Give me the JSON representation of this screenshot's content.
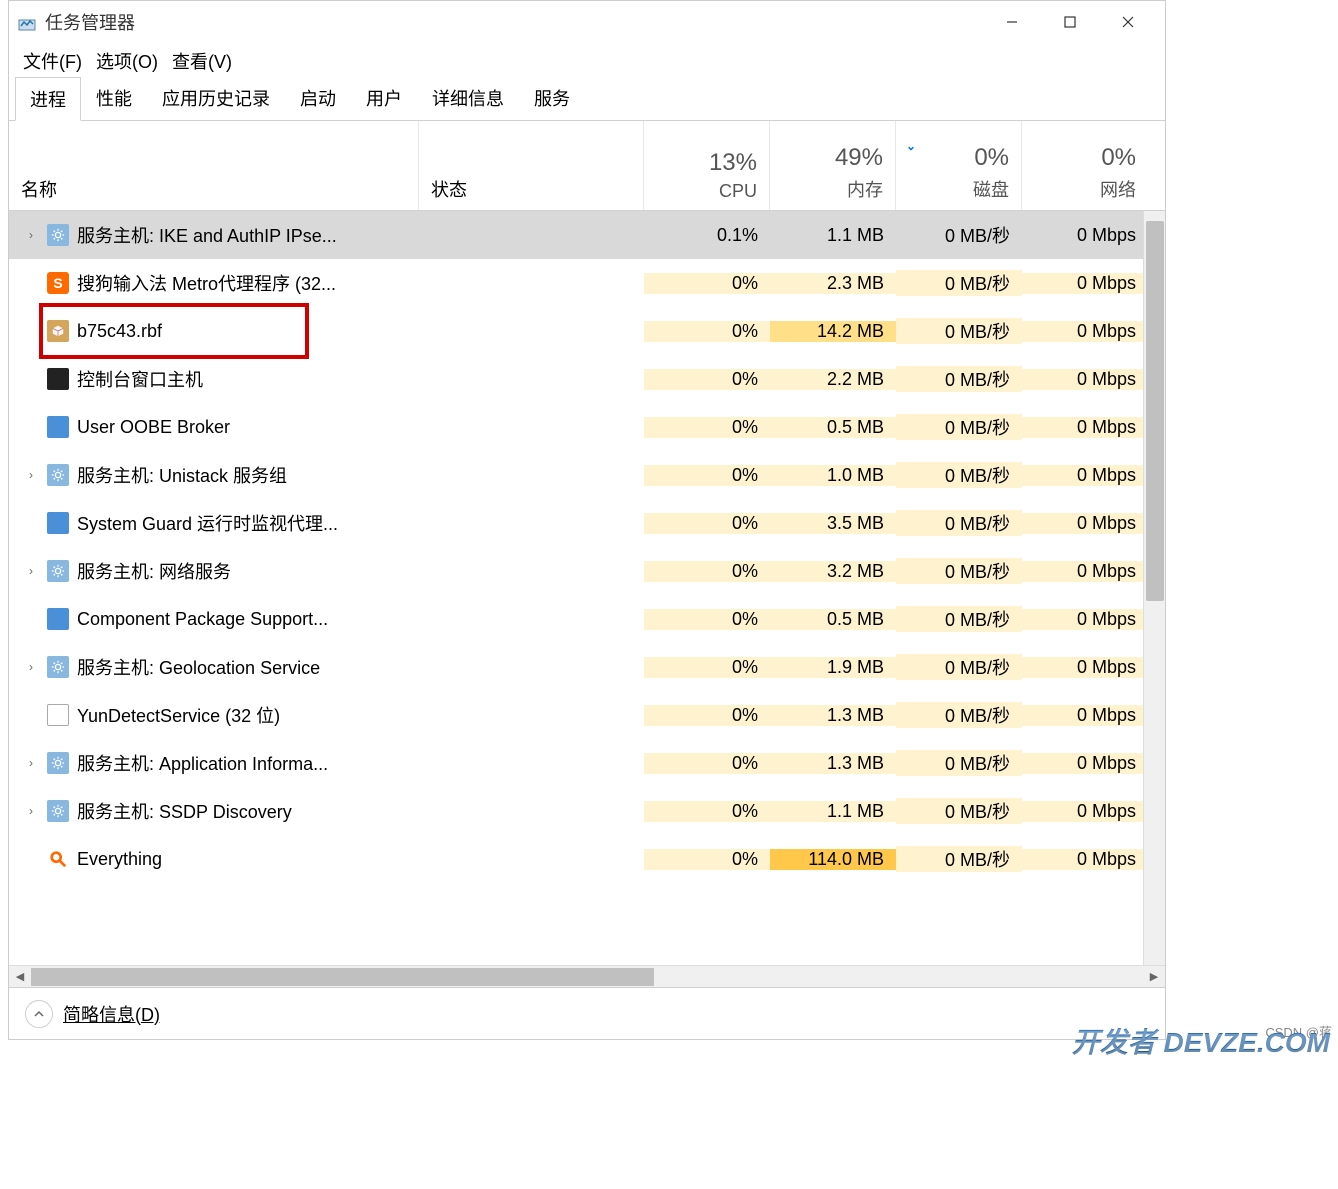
{
  "window": {
    "title": "任务管理器"
  },
  "menu": {
    "file": "文件(F)",
    "options": "选项(O)",
    "view": "查看(V)"
  },
  "tabs": [
    "进程",
    "性能",
    "应用历史记录",
    "启动",
    "用户",
    "详细信息",
    "服务"
  ],
  "activeTab": 0,
  "columns": {
    "name": "名称",
    "status": "状态",
    "cpu": {
      "pct": "13%",
      "label": "CPU"
    },
    "mem": {
      "pct": "49%",
      "label": "内存"
    },
    "disk": {
      "pct": "0%",
      "label": "磁盘"
    },
    "net": {
      "pct": "0%",
      "label": "网络"
    }
  },
  "rows": [
    {
      "expandable": true,
      "icon": "gear",
      "name": "服务主机: IKE and AuthIP IPse...",
      "cpu": "0.1%",
      "mem": "1.1 MB",
      "disk": "0 MB/秒",
      "net": "0 Mbps",
      "selected": true
    },
    {
      "expandable": false,
      "icon": "sogou",
      "name": "搜狗输入法 Metro代理程序 (32...",
      "cpu": "0%",
      "mem": "2.3 MB",
      "disk": "0 MB/秒",
      "net": "0 Mbps"
    },
    {
      "expandable": false,
      "icon": "box",
      "name": "b75c43.rbf",
      "cpu": "0%",
      "mem": "14.2 MB",
      "disk": "0 MB/秒",
      "net": "0 Mbps",
      "highlighted": true
    },
    {
      "expandable": false,
      "icon": "console",
      "name": "控制台窗口主机",
      "cpu": "0%",
      "mem": "2.2 MB",
      "disk": "0 MB/秒",
      "net": "0 Mbps"
    },
    {
      "expandable": false,
      "icon": "blue",
      "name": "User OOBE Broker",
      "cpu": "0%",
      "mem": "0.5 MB",
      "disk": "0 MB/秒",
      "net": "0 Mbps"
    },
    {
      "expandable": true,
      "icon": "gear",
      "name": "服务主机: Unistack 服务组",
      "cpu": "0%",
      "mem": "1.0 MB",
      "disk": "0 MB/秒",
      "net": "0 Mbps"
    },
    {
      "expandable": false,
      "icon": "blue",
      "name": "System Guard 运行时监视代理...",
      "cpu": "0%",
      "mem": "3.5 MB",
      "disk": "0 MB/秒",
      "net": "0 Mbps"
    },
    {
      "expandable": true,
      "icon": "gear",
      "name": "服务主机: 网络服务",
      "cpu": "0%",
      "mem": "3.2 MB",
      "disk": "0 MB/秒",
      "net": "0 Mbps"
    },
    {
      "expandable": false,
      "icon": "blue",
      "name": "Component Package Support...",
      "cpu": "0%",
      "mem": "0.5 MB",
      "disk": "0 MB/秒",
      "net": "0 Mbps"
    },
    {
      "expandable": true,
      "icon": "gear",
      "name": "服务主机: Geolocation Service",
      "cpu": "0%",
      "mem": "1.9 MB",
      "disk": "0 MB/秒",
      "net": "0 Mbps"
    },
    {
      "expandable": false,
      "icon": "doc",
      "name": "YunDetectService (32 位)",
      "cpu": "0%",
      "mem": "1.3 MB",
      "disk": "0 MB/秒",
      "net": "0 Mbps"
    },
    {
      "expandable": true,
      "icon": "gear",
      "name": "服务主机: Application Informa...",
      "cpu": "0%",
      "mem": "1.3 MB",
      "disk": "0 MB/秒",
      "net": "0 Mbps"
    },
    {
      "expandable": true,
      "icon": "gear",
      "name": "服务主机: SSDP Discovery",
      "cpu": "0%",
      "mem": "1.1 MB",
      "disk": "0 MB/秒",
      "net": "0 Mbps"
    },
    {
      "expandable": false,
      "icon": "search",
      "name": "Everything",
      "cpu": "0%",
      "mem": "114.0 MB",
      "disk": "0 MB/秒",
      "net": "0 Mbps"
    }
  ],
  "footer": {
    "brief": "简略信息(D)"
  },
  "watermark1": "CSDN @蒋",
  "watermark2": "开发者 DEVZE.COM"
}
